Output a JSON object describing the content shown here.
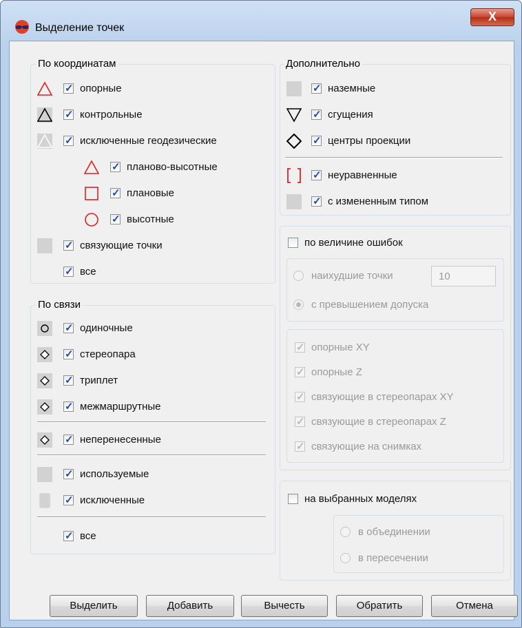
{
  "window": {
    "title": "Выделение точек",
    "close_glyph": "X"
  },
  "by_coordinates": {
    "title": "По координатам",
    "items": [
      {
        "label": "опорные",
        "checked": true
      },
      {
        "label": "контрольные",
        "checked": true
      },
      {
        "label": "исключенные геодезические",
        "checked": true
      },
      {
        "label": "планово-высотные",
        "checked": true
      },
      {
        "label": "плановые",
        "checked": true
      },
      {
        "label": "высотные",
        "checked": true
      },
      {
        "label": "связующие точки",
        "checked": true
      },
      {
        "label": "все",
        "checked": true
      }
    ]
  },
  "by_link": {
    "title": "По связи",
    "items": [
      {
        "label": "одиночные",
        "checked": true
      },
      {
        "label": "стереопара",
        "checked": true
      },
      {
        "label": "триплет",
        "checked": true
      },
      {
        "label": "межмаршрутные",
        "checked": true
      },
      {
        "label": "неперенесенные",
        "checked": true
      },
      {
        "label": "используемые",
        "checked": true
      },
      {
        "label": "исключенные",
        "checked": true
      },
      {
        "label": "все",
        "checked": true
      }
    ]
  },
  "additional": {
    "title": "Дополнительно",
    "items": [
      {
        "label": "наземные",
        "checked": true
      },
      {
        "label": "сгущения",
        "checked": true
      },
      {
        "label": "центры проекции",
        "checked": true
      },
      {
        "label": "неуравненные",
        "checked": true
      },
      {
        "label": "с измененным типом",
        "checked": true
      }
    ]
  },
  "by_errors": {
    "label": "по величине ошибок",
    "checked": false,
    "worst_label": "наихудшие точки",
    "worst_value": "10",
    "tolerance_label": "с превышением допуска",
    "items": [
      {
        "label": "опорные XY",
        "checked": true
      },
      {
        "label": "опорные Z",
        "checked": true
      },
      {
        "label": "связующие в стереопарах XY",
        "checked": true
      },
      {
        "label": "связующие в стереопарах Z",
        "checked": true
      },
      {
        "label": "связующие на снимках",
        "checked": true
      }
    ]
  },
  "on_models": {
    "label": "на выбранных моделях",
    "checked": false,
    "union_label": "в объединении",
    "intersection_label": "в пересечении"
  },
  "buttons": {
    "select": "Выделить",
    "add": "Добавить",
    "subtract": "Вычесть",
    "invert": "Обратить",
    "cancel": "Отмена"
  },
  "colors": {
    "control_red": "#e02020",
    "title_gradient": "#b9d1ec",
    "close_red": "#c9432d",
    "check_blue": "#2b4aa3"
  }
}
